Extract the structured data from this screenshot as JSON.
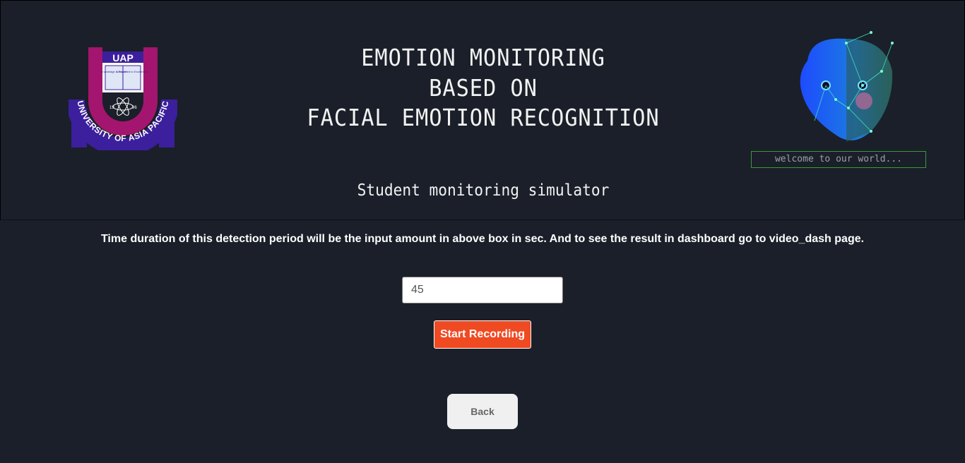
{
  "header": {
    "title_line1": "EMOTION MONITORING",
    "title_line2": "BASED ON",
    "title_line3": "FACIAL EMOTION RECOGNITION",
    "subtitle": "Student monitoring simulator",
    "logo": {
      "icon": "university-logo-icon",
      "abbr": "UAP",
      "university_name": "UNIVERSITY OF ASIA PACIFIC",
      "motto_left": "Knowledge is Power",
      "motto_right": "Committed to Excellence",
      "year_left": "19",
      "year_right": "96"
    },
    "face_icon": "ai-face-icon",
    "welcome_text": "welcome to our world..."
  },
  "main": {
    "info_text": "Time duration of this detection period will be the input amount in above box in sec. And to see the result in dashboard go to video_dash page.",
    "duration_value": "45",
    "start_label": "Start Recording",
    "back_label": "Back"
  },
  "colors": {
    "background": "#1a1f29",
    "start_button": "#f04a23",
    "back_button": "#f0f0f0",
    "welcome_border": "#3a9a3a",
    "logo_magenta": "#a3156e",
    "logo_purple": "#3b1f9c"
  }
}
